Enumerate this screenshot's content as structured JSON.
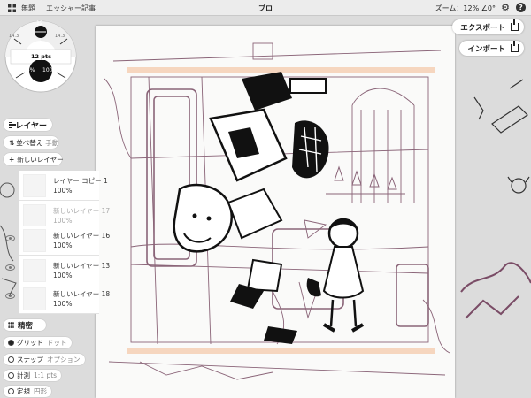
{
  "topbar": {
    "breadcrumb_1": "無題",
    "breadcrumb_2": "エッシャー記事",
    "title": "プロ",
    "zoom": "ズーム：12% ∠0°"
  },
  "brush_wheel": {
    "top_value": "12",
    "size_readout": "12 pts",
    "opacity_left": "14%",
    "opacity_right": "100%",
    "tick_left": "14.3",
    "tick_right": "14.3"
  },
  "layers": {
    "header": "レイヤー",
    "sort_label": "並べ替え",
    "sort_mode": "手動",
    "new_layer_label": "新しいレイヤー",
    "items": [
      {
        "name": "レイヤー コピー 1",
        "opacity": "100%"
      },
      {
        "name": "新しいレイヤー 17",
        "opacity": "100%"
      },
      {
        "name": "新しいレイヤー 16",
        "opacity": "100%"
      },
      {
        "name": "新しいレイヤー 13",
        "opacity": "100%"
      },
      {
        "name": "新しいレイヤー 18",
        "opacity": "100%"
      }
    ]
  },
  "precision": {
    "header": "精密",
    "options": [
      {
        "label": "グリッド",
        "value": "ドット",
        "on": true
      },
      {
        "label": "スナップ",
        "value": "オプション",
        "on": false
      },
      {
        "label": "計測",
        "value": "1:1 pts",
        "on": false
      },
      {
        "label": "定規",
        "value": "円形",
        "on": false
      }
    ]
  },
  "actions": {
    "export_label": "エクスポート",
    "import_label": "インポート"
  },
  "colors": {
    "sketch_purple": "#8a6478",
    "ink": "#111111",
    "peach_guide": "#f6d6bf"
  }
}
